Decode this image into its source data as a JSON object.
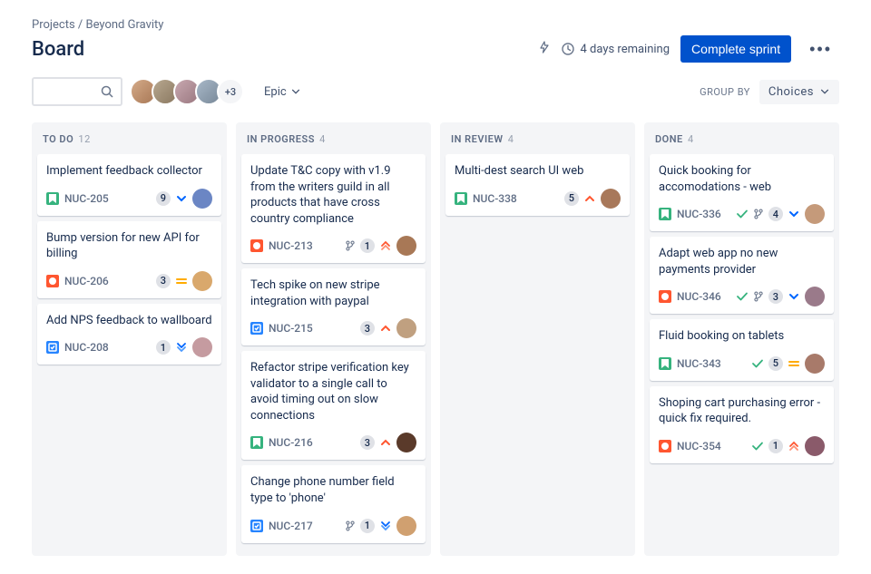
{
  "breadcrumb": {
    "parent": "Projects",
    "project": "Beyond Gravity"
  },
  "header": {
    "title": "Board",
    "days_remaining": "4 days remaining",
    "complete_sprint": "Complete sprint"
  },
  "toolbar": {
    "avatar_overflow": "+3",
    "epic_label": "Epic",
    "group_by_label": "Group by",
    "choices_label": "Choices"
  },
  "columns": [
    {
      "name": "To do",
      "count": "12"
    },
    {
      "name": "In progress",
      "count": "4"
    },
    {
      "name": "In review",
      "count": "4"
    },
    {
      "name": "Done",
      "count": "4"
    }
  ],
  "cards": {
    "todo": [
      {
        "title": "Implement feedback collector",
        "key": "NUC-205",
        "type": "story",
        "count": "9",
        "priority": "low",
        "avatar": "#6b86c4"
      },
      {
        "title": "Bump version for new API for billing",
        "key": "NUC-206",
        "type": "bug",
        "count": "3",
        "priority": "medium",
        "avatar": "#d9a86c"
      },
      {
        "title": "Add NPS feedback to wallboard",
        "key": "NUC-208",
        "type": "task",
        "count": "1",
        "priority": "lowest",
        "avatar": "#c59ba0"
      }
    ],
    "inprogress": [
      {
        "title": "Update T&C copy with v1.9 from the writers guild in all products that have cross country compliance",
        "key": "NUC-213",
        "type": "bug",
        "branch": true,
        "count": "1",
        "priority": "highest",
        "avatar": "#a87856"
      },
      {
        "title": "Tech spike on new stripe integration with paypal",
        "key": "NUC-215",
        "type": "task",
        "count": "3",
        "priority": "high",
        "avatar": "#c0a080"
      },
      {
        "title": "Refactor stripe verification key validator to a single call to avoid timing out on slow connections",
        "key": "NUC-216",
        "type": "story",
        "count": "3",
        "priority": "high",
        "avatar": "#5a3a2a"
      },
      {
        "title": "Change phone number field type to 'phone'",
        "key": "NUC-217",
        "type": "task",
        "branch": true,
        "count": "1",
        "priority": "lowest",
        "avatar": "#d0a070"
      }
    ],
    "inreview": [
      {
        "title": "Multi-dest search UI web",
        "key": "NUC-338",
        "type": "story",
        "count": "5",
        "priority": "high",
        "avatar": "#a8785a"
      }
    ],
    "done": [
      {
        "title": "Quick booking for accomodations - web",
        "key": "NUC-336",
        "type": "story",
        "done": true,
        "branch": true,
        "count": "4",
        "priority": "low",
        "avatar": "#c59a7a"
      },
      {
        "title": "Adapt web app no new payments provider",
        "key": "NUC-346",
        "type": "bug",
        "done": true,
        "branch": true,
        "count": "3",
        "priority": "low",
        "avatar": "#9a7a8a"
      },
      {
        "title": "Fluid booking on tablets",
        "key": "NUC-343",
        "type": "story",
        "done": true,
        "count": "5",
        "priority": "medium",
        "avatar": "#a87a6a"
      },
      {
        "title": "Shoping cart purchasing error - quick fix required.",
        "key": "NUC-354",
        "type": "bug",
        "done": true,
        "count": "1",
        "priority": "highest",
        "avatar": "#8a5a6a"
      }
    ]
  }
}
